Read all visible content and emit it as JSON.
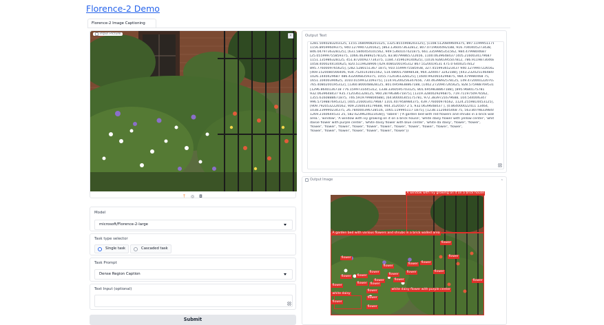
{
  "app": {
    "title": "Florence-2 Demo"
  },
  "tabs": [
    {
      "label": "Florence-2 Image Captioning"
    }
  ],
  "input": {
    "picture_label": "Input Picture",
    "clear_icon": "close-icon",
    "tools": [
      "download-icon",
      "share-icon",
      "webcam-icon"
    ]
  },
  "model": {
    "label": "Model",
    "value": "microsoft/Florence-2-large"
  },
  "task_type": {
    "label": "Task type selector",
    "options": [
      {
        "label": "Single task",
        "selected": true
      },
      {
        "label": "Cascaded task",
        "selected": false
      }
    ]
  },
  "task_prompt": {
    "label": "Task Prompt",
    "value": "Dense Region Caption"
  },
  "text_input": {
    "label": "Text Input (optional)",
    "value": ""
  },
  "submit": {
    "label": "Submit"
  },
  "output_text": {
    "label": "Output Text",
    "lines": [
      "1281.5040283203125, 1155.1680908203125, 1325.8555908203125], [1108.5120849609375, 897.1199951171875,",
      "1156.89599609375, 940.1279907226562], [863.1360473632812, 807.0719604492188, 916.7040405273438,",
      "846.0479736328125], [631.5840454101562, 949.5360107421875, 661.3359985351562, 984.4799804687",
      "[25.055999755859375, 1066.4639892578125, 83.80799865722656, 1100.0639648437 [405.2160034179687",
      "1151.135986328125, 451.87200927734375, 1184.7359619140625], [1016.9280395507812, 786.9119873046875,",
      "1058.4000244140625, 820.5119628906 [429.4080200195312 867.5520019531 475.0 6400257812",
      "895.7760009765625], [282.5280151367 1875, 910.5599975585938, 327.4559936523437 940.1279907226562],",
      "[469.1520080566406, 934.7520141601562, 514.0800170898438, 964.320007 3242188], [443.2320251464844,",
      "1026.1440429687 486.4320068359375, 1055.7120361328125], [1600.9920654296875, 984.479980468 75,",
      "1651.10400390625, 1010.0159912109375], [114.91200256347656, 730.4639892578125, 149.4720001220703,",
      "765.4080200195312], [1360.800048828125, 801.6959838867188, [1402.2720947265625, 828.5759887695312],",
      "[1296.8640136718 776.1599731445312, 1338.3360595703125, 801.6959838867188], [895.9680175781",
      "932.0639648437 935.7120361328125, 960.2879638671875], [1319.3280029296875, 719.7119750976562,",
      "1355.6160888671875, 746.5919799804688], [64.80000305175781, 972.3839721679688, 104.544006347",
      "996.5759887695312], [405.2160034179687 1101.407958984375, 439.776000976562, 1124.2559814453125],",
      "[909.7920532226562, 909.2160034179688, 944.3520507 2 5, 932.0639648437 ], [0.864000022411 13464,",
      "1038.239990234375, 26.784000396728516, 1065.119995117 1875], [1238.1120605468 75, 563.80798339844375,",
      "1269.2160644531 25, 582.6239624023438]], 'labels': ['A garden bed with red flowers and shrubs in a brick walled",
      "area.', 'window', 'A window with ivy growing on it on a brick house', 'white daisy flower with yellow center', 'white",
      "daisie flower with purple center', 'white daisy flower with blue center', 'white da daisy', 'flower', 'flower',",
      "'flower', 'flower', 'flower', 'flower', 'flower', 'flower', 'flower', 'flower', 'flower', 'flower', 'flower',",
      "'flower', 'flower', 'flower', 'flower', 'flower', 'flower', 'flower']}"
    ]
  },
  "output_image": {
    "label": "Output Image",
    "collapse_icon": "chevron-up-icon",
    "annotations": [
      "A window with ivy growing on it on a brick house",
      "A garden bed with various flowers and shrubs in a brick walled area",
      "flower",
      "white daisy",
      "white daisy flower with purple center"
    ]
  },
  "colors": {
    "accent": "#2563eb",
    "box": "#e0312a",
    "border": "#e5e7eb"
  }
}
